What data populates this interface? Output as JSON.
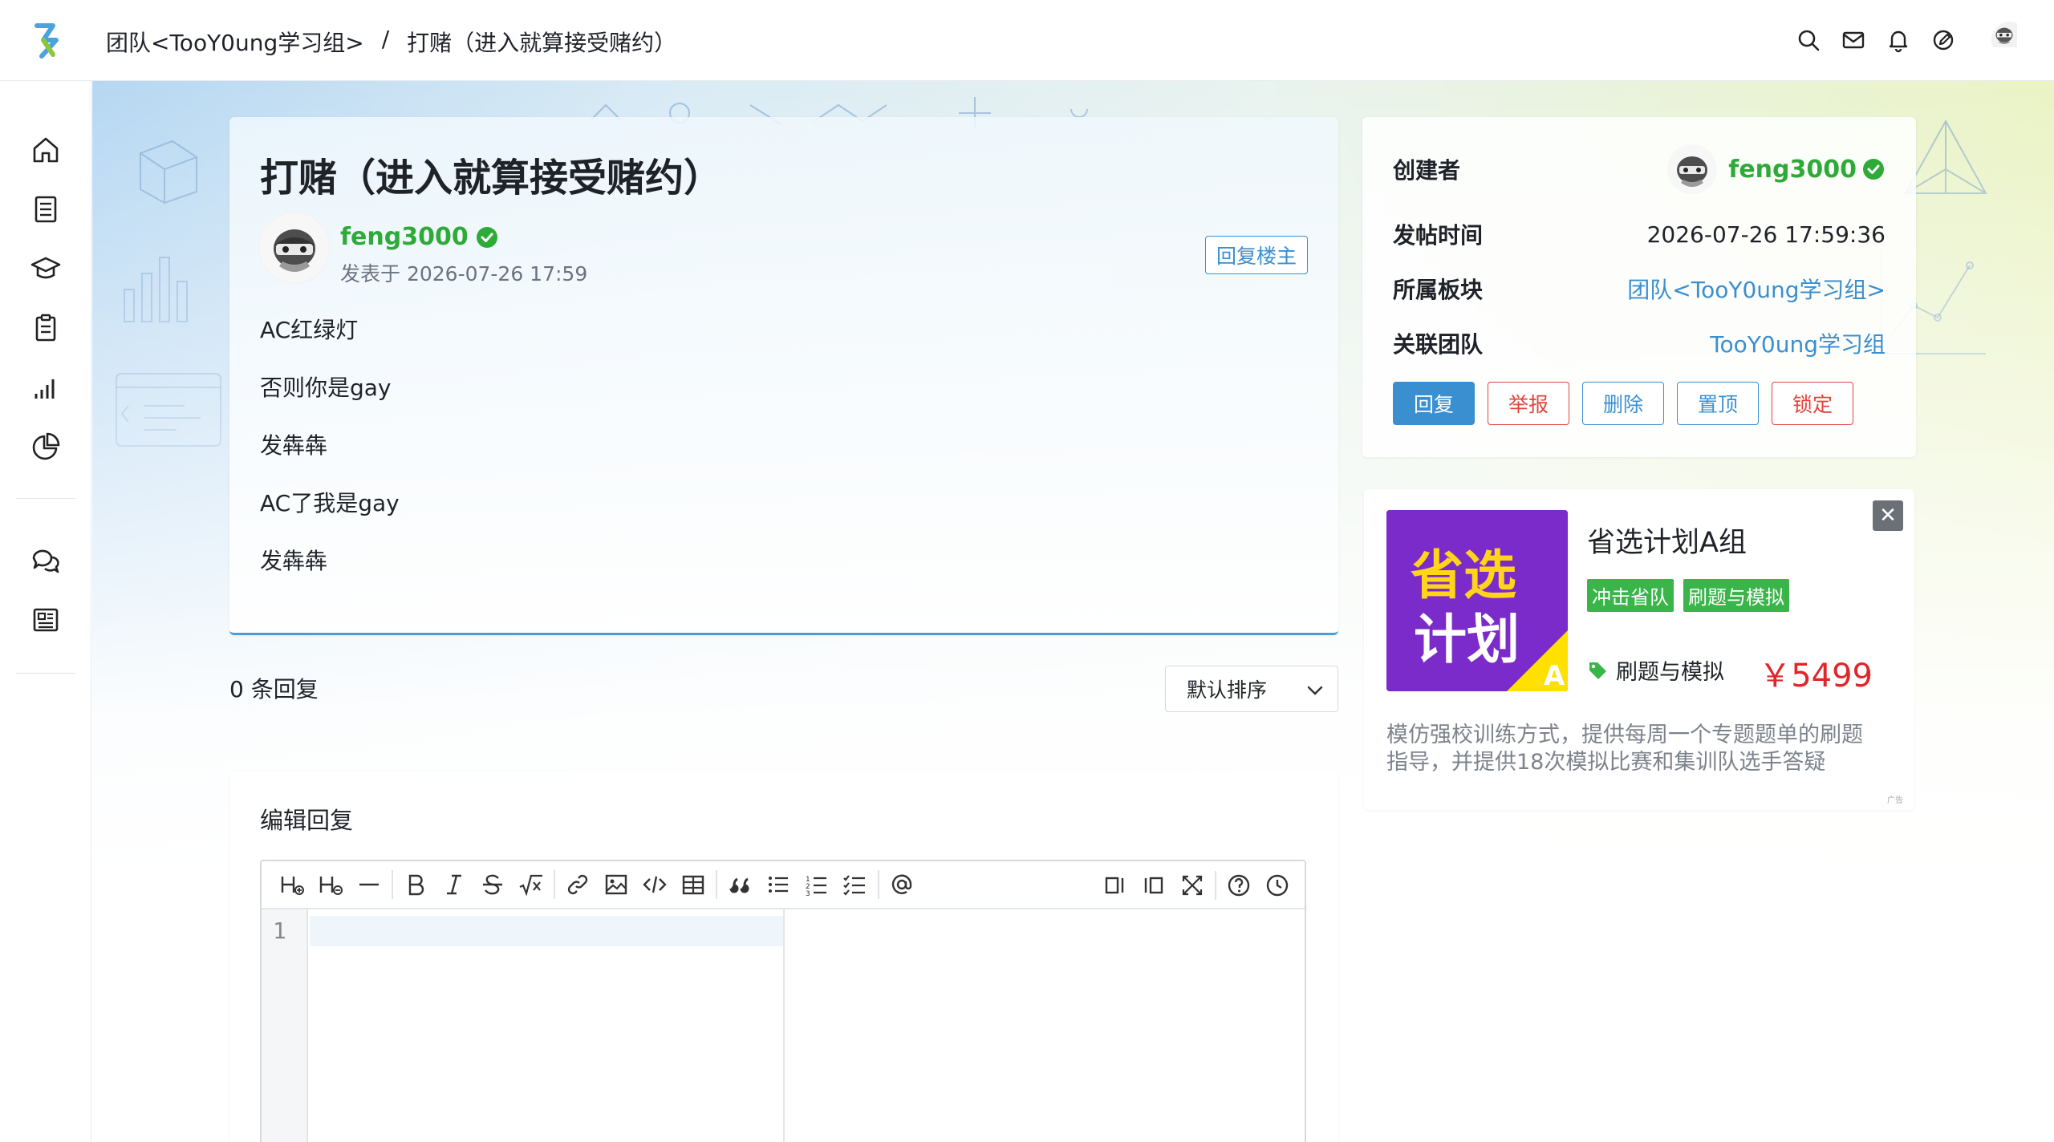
{
  "breadcrumb": {
    "team": "团队<TooY0ung学习组>",
    "separator": "/",
    "current": "打赌（进入就算接受赌约）"
  },
  "post": {
    "title": "打赌（进入就算接受赌约）",
    "author": "feng3000",
    "posted_at": "发表于  2026-07-26 17:59",
    "reply_host_label": "回复楼主",
    "body": [
      "AC红绿灯",
      "否则你是gay",
      "发犇犇",
      "AC了我是gay",
      "发犇犇"
    ]
  },
  "replies": {
    "count_label": "0 条回复",
    "sort_selected": "默认排序"
  },
  "editor": {
    "title": "编辑回复",
    "line_number": "1"
  },
  "info": {
    "creator_label": "创建者",
    "creator_name": "feng3000",
    "time_label": "发帖时间",
    "time_value": "2026-07-26 17:59:36",
    "board_label": "所属板块",
    "board_value": "团队<TooY0ung学习组>",
    "team_label": "关联团队",
    "team_value": "TooY0ung学习组",
    "buttons": {
      "reply": "回复",
      "report": "举报",
      "delete": "删除",
      "pin": "置顶",
      "lock": "锁定"
    }
  },
  "ad": {
    "image_line1": "省选",
    "image_line2": "计划",
    "image_badge": "A",
    "title": "省选计划A组",
    "tags": [
      "冲击省队",
      "刷题与模拟"
    ],
    "category": "刷题与模拟",
    "price": "￥5499",
    "description": "模仿强校训练方式，提供每周一个专题题单的刷题指导，并提供18次模拟比赛和集训队选手答疑",
    "close": "✕",
    "mark": "广告"
  },
  "colors": {
    "accent": "#3a8fd0",
    "author_green": "#2eaa38",
    "danger": "#e0453c",
    "price": "#e0252b",
    "tag_green": "#39b54a"
  }
}
